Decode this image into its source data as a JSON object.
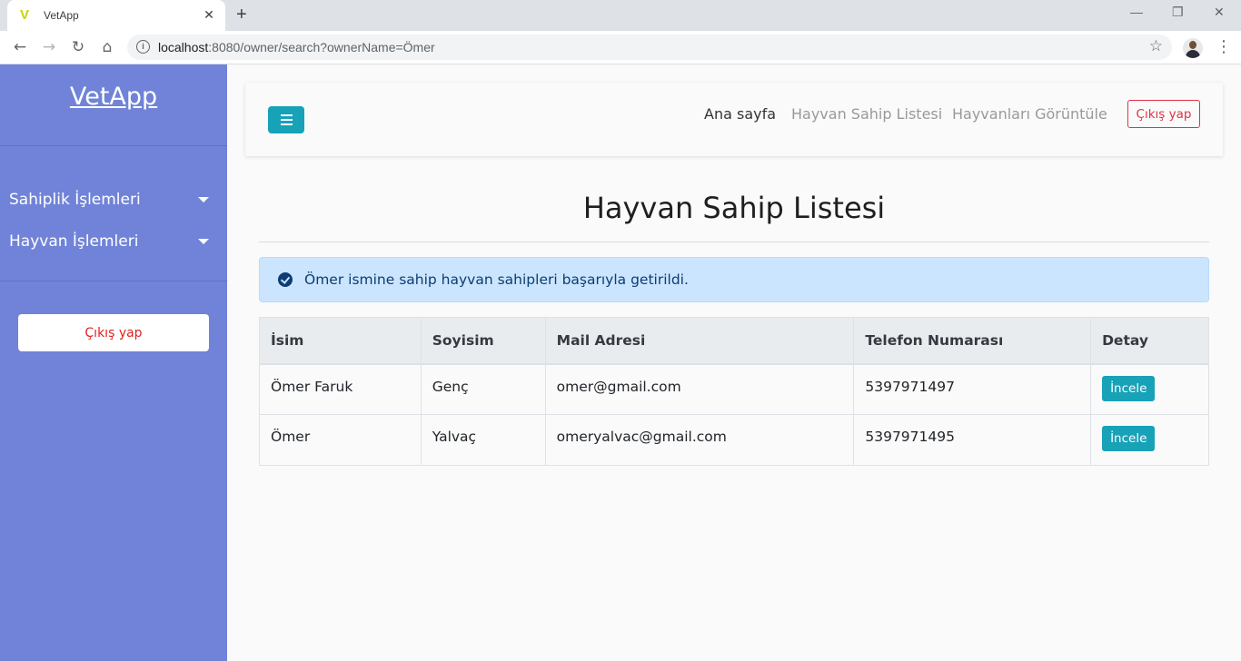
{
  "browser": {
    "tab_title": "VetApp",
    "tab_favicon": "V",
    "url_host": "localhost",
    "url_rest": ":8080/owner/search?ownerName=Ömer"
  },
  "sidebar": {
    "brand": "VetApp",
    "items": [
      {
        "label": "Sahiplik İşlemleri"
      },
      {
        "label": "Hayvan İşlemleri"
      }
    ],
    "logout_label": "Çıkış yap"
  },
  "topnav": {
    "links": [
      {
        "label": "Ana sayfa"
      },
      {
        "label": "Hayvan Sahip Listesi"
      },
      {
        "label": "Hayvanları Görüntüle"
      }
    ],
    "logout_label": "Çıkış yap"
  },
  "main": {
    "title": "Hayvan Sahip Listesi",
    "alert": "Ömer ismine sahip hayvan sahipleri başarıyla getirildi.",
    "table": {
      "headers": [
        "İsim",
        "Soyisim",
        "Mail Adresi",
        "Telefon Numarası",
        "Detay"
      ],
      "rows": [
        {
          "name": "Ömer Faruk",
          "surname": "Genç",
          "email": "omer@gmail.com",
          "phone": "5397971497",
          "action": "İncele"
        },
        {
          "name": "Ömer",
          "surname": "Yalvaç",
          "email": "omeryalvac@gmail.com",
          "phone": "5397971495",
          "action": "İncele"
        }
      ]
    }
  },
  "colors": {
    "sidebar_bg": "#7083d8",
    "accent": "#17a2b8",
    "danger": "#dc3545",
    "alert_bg": "#cce5fe"
  }
}
